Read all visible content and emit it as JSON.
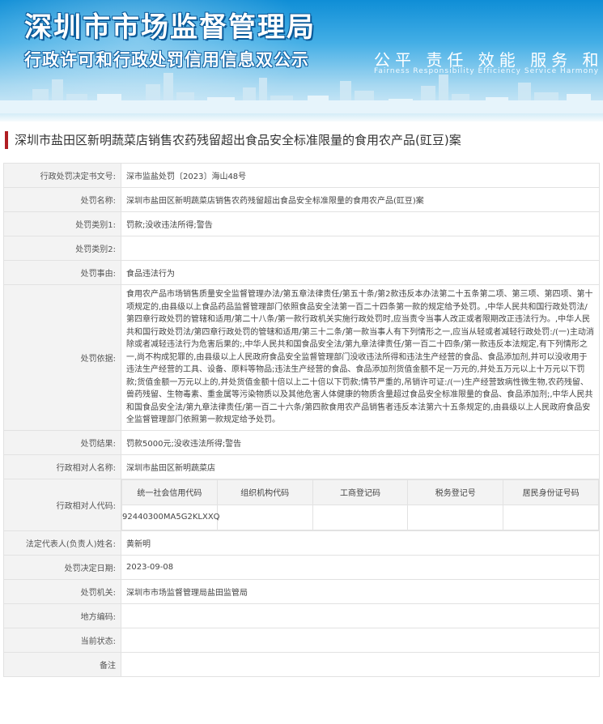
{
  "header": {
    "title_main": "深圳市市场监督管理局",
    "title_sub": "行政许可和行政处罚信用信息双公示",
    "slogan": [
      "公平",
      "责任",
      "效能",
      "服务",
      "和谐"
    ],
    "slogan_en": "Fairness  Responsibility  Efficiency  Service  Harmony"
  },
  "case_title": "深圳市盐田区新明蔬菜店销售农药残留超出食品安全标准限量的食用农产品(豇豆)案",
  "fields": {
    "decision_no": {
      "label": "行政处罚决定书文号:",
      "value": "深市监盐处罚〔2023〕海山48号"
    },
    "case_name": {
      "label": "处罚名称:",
      "value": "深圳市盐田区新明蔬菜店销售农药残留超出食品安全标准限量的食用农产品(豇豆)案"
    },
    "category1": {
      "label": "处罚类别1:",
      "value": "罚款;没收违法所得;警告"
    },
    "category2": {
      "label": "处罚类别2:",
      "value": ""
    },
    "reason": {
      "label": "处罚事由:",
      "value": "食品违法行为"
    },
    "basis": {
      "label": "处罚依据:",
      "value": "食用农产品市场销售质量安全监督管理办法/第五章法律责任/第五十条/第2款违反本办法第二十五条第二项、第三项、第四项、第十项规定的,由县级以上食品药品监督管理部门依照食品安全法第一百二十四条第一款的规定给予处罚。,中华人民共和国行政处罚法/第四章行政处罚的管辖和适用/第二十八条/第一款行政机关实施行政处罚时,应当责令当事人改正或者限期改正违法行为。,中华人民共和国行政处罚法/第四章行政处罚的管辖和适用/第三十二条/第一款当事人有下列情形之一,应当从轻或者减轻行政处罚:/(一)主动消除或者减轻违法行为危害后果的;,中华人民共和国食品安全法/第九章法律责任/第一百二十四条/第一款违反本法规定,有下列情形之一,尚不构成犯罪的,由县级以上人民政府食品安全监督管理部门没收违法所得和违法生产经营的食品、食品添加剂,并可以没收用于违法生产经营的工具、设备、原料等物品;违法生产经营的食品、食品添加剂货值金额不足一万元的,并处五万元以上十万元以下罚款;货值金额一万元以上的,并处货值金额十倍以上二十倍以下罚款;情节严重的,吊销许可证:/(一)生产经营致病性微生物,农药残留、兽药残留、生物毒素、重金属等污染物质以及其他危害人体健康的物质含量超过食品安全标准限量的食品、食品添加剂;,中华人民共和国食品安全法/第九章法律责任/第一百二十六条/第四款食用农产品销售者违反本法第六十五条规定的,由县级以上人民政府食品安全监督管理部门依照第一款规定给予处罚。"
    },
    "result": {
      "label": "处罚结果:",
      "value": "罚款5000元;没收违法所得;警告"
    },
    "party_name": {
      "label": "行政相对人名称:",
      "value": "深圳市盐田区新明蔬菜店"
    },
    "party_code": {
      "label": "行政相对人代码:",
      "headers": [
        "统一社会信用代码",
        "组织机构代码",
        "工商登记码",
        "税务登记号",
        "居民身份证号码"
      ],
      "values": [
        "92440300MA5G2KLXXQ",
        "",
        "",
        "",
        ""
      ]
    },
    "legal_rep": {
      "label": "法定代表人(负责人)姓名:",
      "value": "黄新明"
    },
    "decision_date": {
      "label": "处罚决定日期:",
      "value": "2023-09-08"
    },
    "authority": {
      "label": "处罚机关:",
      "value": "深圳市市场监督管理局盐田监管局"
    },
    "region_code": {
      "label": "地方编码:",
      "value": ""
    },
    "status": {
      "label": "当前状态:",
      "value": ""
    },
    "remark": {
      "label": "备注",
      "value": ""
    }
  }
}
